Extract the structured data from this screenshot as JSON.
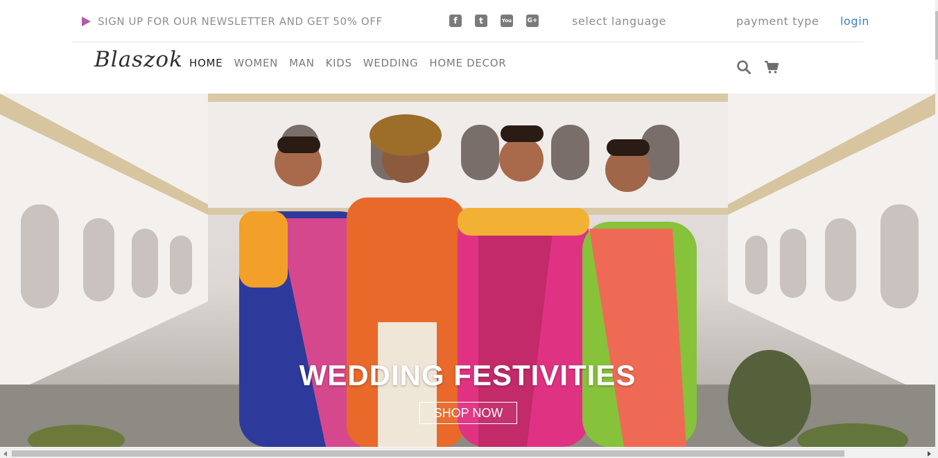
{
  "topbar": {
    "newsletter": "SIGN UP FOR OUR NEWSLETTER AND GET 50% OFF",
    "social": [
      {
        "icon": "facebook-icon",
        "glyph": "f"
      },
      {
        "icon": "twitter-icon",
        "glyph": "t"
      },
      {
        "icon": "youtube-icon",
        "glyph": "You"
      },
      {
        "icon": "google-plus-icon",
        "glyph": "G+"
      }
    ],
    "language": "select language",
    "payment": "payment type",
    "login": "login"
  },
  "nav": {
    "logo": "Blaszok",
    "items": [
      {
        "label": "HOME",
        "active": true
      },
      {
        "label": "WOMEN",
        "active": false
      },
      {
        "label": "MAN",
        "active": false
      },
      {
        "label": "KIDS",
        "active": false
      },
      {
        "label": "WEDDING",
        "active": false
      },
      {
        "label": "HOME DECOR",
        "active": false
      }
    ],
    "icons": [
      "search-icon",
      "cart-icon"
    ]
  },
  "hero": {
    "title": "WEDDING FESTIVITIES",
    "button": "SHOP NOW"
  },
  "colors": {
    "accent": "#b45aa9",
    "login_link": "#3a7fc1",
    "menu_text": "#7a7a7a",
    "menu_active": "#222222"
  }
}
